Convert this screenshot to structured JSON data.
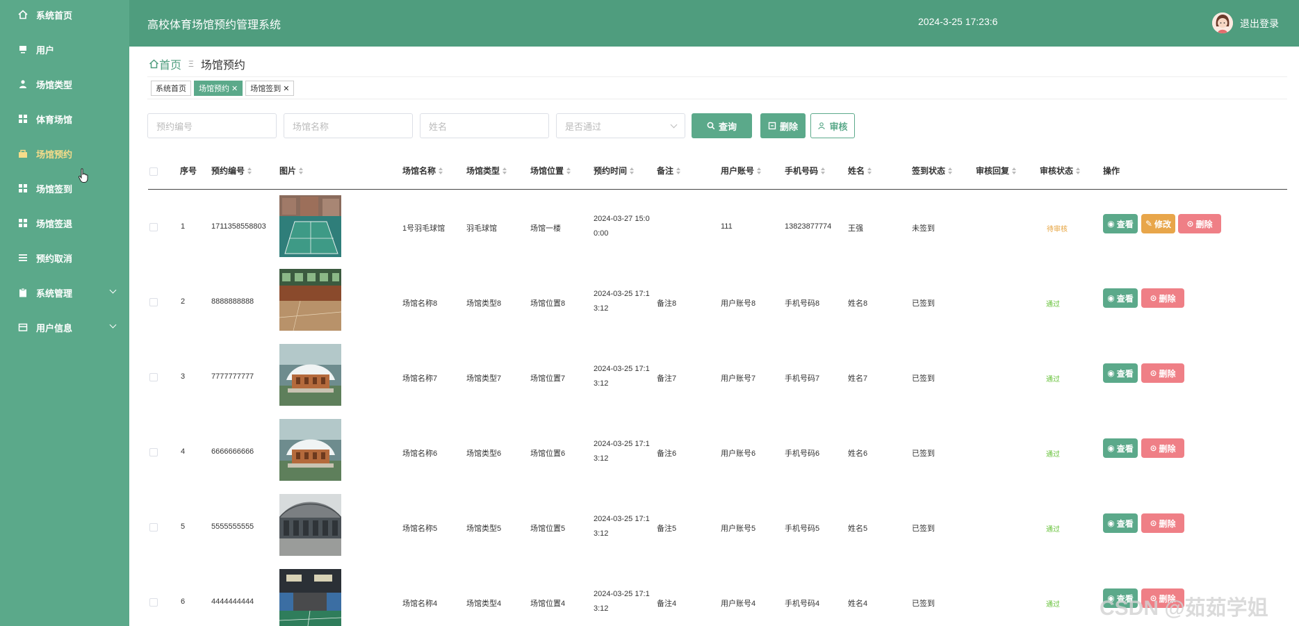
{
  "sidebar": {
    "items": [
      {
        "label": "系统首页",
        "icon": "home-icon"
      },
      {
        "label": "用户",
        "icon": "monitor-icon"
      },
      {
        "label": "场馆类型",
        "icon": "person-icon"
      },
      {
        "label": "体育场馆",
        "icon": "grid-icon"
      },
      {
        "label": "场馆预约",
        "icon": "bag-icon",
        "active": true
      },
      {
        "label": "场馆签到",
        "icon": "grid-icon"
      },
      {
        "label": "场馆签退",
        "icon": "grid-icon"
      },
      {
        "label": "预约取消",
        "icon": "list-icon"
      },
      {
        "label": "系统管理",
        "icon": "clipboard-icon",
        "expandable": true
      },
      {
        "label": "用户信息",
        "icon": "card-icon",
        "expandable": true
      }
    ]
  },
  "header": {
    "title": "高校体育场馆预约管理系统",
    "datetime": "2024-3-25 17:23:6",
    "logout": "退出登录"
  },
  "breadcrumb": {
    "home": "首页",
    "current": "场馆预约"
  },
  "tabs": [
    {
      "label": "系统首页",
      "closable": false,
      "active": false
    },
    {
      "label": "场馆预约",
      "closable": true,
      "active": true
    },
    {
      "label": "场馆签到",
      "closable": true,
      "active": false
    }
  ],
  "search": {
    "booking_no_placeholder": "预约编号",
    "venue_name_placeholder": "场馆名称",
    "name_placeholder": "姓名",
    "approved_placeholder": "是否通过",
    "query_label": "查询",
    "delete_label": "删除",
    "review_label": "审核"
  },
  "table": {
    "headers": [
      "序号",
      "预约编号",
      "图片",
      "场馆名称",
      "场馆类型",
      "场馆位置",
      "预约时间",
      "备注",
      "用户账号",
      "手机号码",
      "姓名",
      "签到状态",
      "审核回复",
      "审核状态",
      "操作"
    ],
    "rows": [
      {
        "idx": "1",
        "no": "1711358558803",
        "venue": "1号羽毛球馆",
        "type": "羽毛球馆",
        "loc": "场馆一楼",
        "time": "2024-03-27 15:00:00",
        "remark": "",
        "account": "111",
        "phone": "13823877774",
        "name": "王强",
        "checkin": "未签到",
        "reply": "",
        "status": "待审核",
        "status_kind": "pending",
        "img": "outdoor-court"
      },
      {
        "idx": "2",
        "no": "8888888888",
        "venue": "场馆名称8",
        "type": "场馆类型8",
        "loc": "场馆位置8",
        "time": "2024-03-25 17:13:12",
        "remark": "备注8",
        "account": "用户账号8",
        "phone": "手机号码8",
        "name": "姓名8",
        "checkin": "已签到",
        "reply": "",
        "status": "通过",
        "status_kind": "pass",
        "img": "indoor-gym"
      },
      {
        "idx": "3",
        "no": "7777777777",
        "venue": "场馆名称7",
        "type": "场馆类型7",
        "loc": "场馆位置7",
        "time": "2024-03-25 17:13:12",
        "remark": "备注7",
        "account": "用户账号7",
        "phone": "手机号码7",
        "name": "姓名7",
        "checkin": "已签到",
        "reply": "",
        "status": "通过",
        "status_kind": "pass",
        "img": "stadium-aerial"
      },
      {
        "idx": "4",
        "no": "6666666666",
        "venue": "场馆名称6",
        "type": "场馆类型6",
        "loc": "场馆位置6",
        "time": "2024-03-25 17:13:12",
        "remark": "备注6",
        "account": "用户账号6",
        "phone": "手机号码6",
        "name": "姓名6",
        "checkin": "已签到",
        "reply": "",
        "status": "通过",
        "status_kind": "pass",
        "img": "stadium-aerial"
      },
      {
        "idx": "5",
        "no": "5555555555",
        "venue": "场馆名称5",
        "type": "场馆类型5",
        "loc": "场馆位置5",
        "time": "2024-03-25 17:13:12",
        "remark": "备注5",
        "account": "用户账号5",
        "phone": "手机号码5",
        "name": "姓名5",
        "checkin": "已签到",
        "reply": "",
        "status": "通过",
        "status_kind": "pass",
        "img": "arena-interior"
      },
      {
        "idx": "6",
        "no": "4444444444",
        "venue": "场馆名称4",
        "type": "场馆类型4",
        "loc": "场馆位置4",
        "time": "2024-03-25 17:13:12",
        "remark": "备注4",
        "account": "用户账号4",
        "phone": "手机号码4",
        "name": "姓名4",
        "checkin": "已签到",
        "reply": "",
        "status": "通过",
        "status_kind": "pass",
        "img": "badminton-hall"
      }
    ],
    "actions": {
      "view": "查看",
      "edit": "修改",
      "delete": "删除"
    }
  },
  "watermark": "CSDN @茹茹学姐",
  "colors": {
    "primary": "#5ba98a",
    "header": "#4f9d7e",
    "active_menu": "#f6dc8a",
    "pending": "#e6a23c",
    "pass": "#67c23a",
    "danger": "#ef7f86",
    "warning": "#e8a64a"
  }
}
